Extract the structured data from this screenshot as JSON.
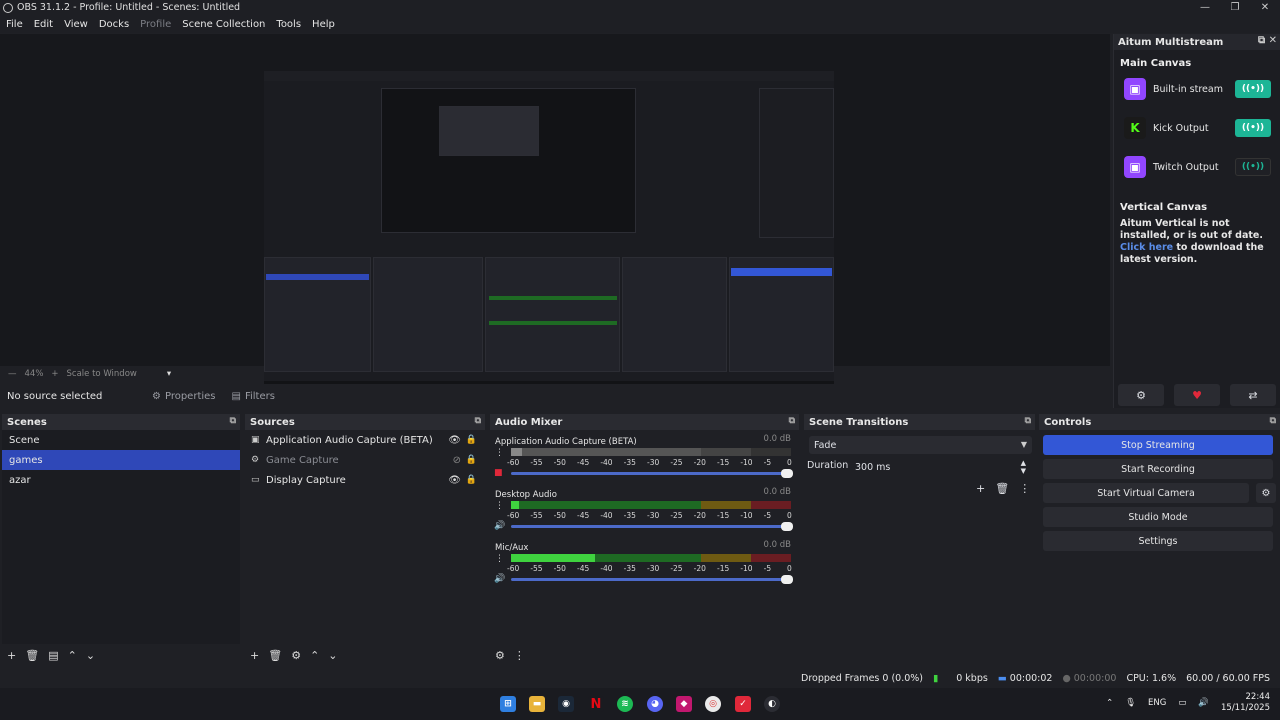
{
  "window": {
    "title": "OBS 31.1.2 - Profile: Untitled - Scenes: Untitled"
  },
  "menu": {
    "items": [
      "File",
      "Edit",
      "View",
      "Docks",
      "Profile",
      "Scene Collection",
      "Tools",
      "Help"
    ]
  },
  "zoom": {
    "percent": "44%",
    "mode": "Scale to Window"
  },
  "source_toolbar": {
    "no_source": "No source selected",
    "properties": "Properties",
    "filters": "Filters"
  },
  "multistream": {
    "title": "Aitum Multistream",
    "main_canvas": "Main Canvas",
    "outputs": [
      {
        "label": "Built-in stream",
        "logo": "twitch-icon",
        "active": true
      },
      {
        "label": "Kick Output",
        "logo": "kick-icon",
        "active": true
      },
      {
        "label": "Twitch Output",
        "logo": "twitch-icon",
        "active": false
      }
    ],
    "vertical_canvas": "Vertical Canvas",
    "vertical_msg": "Aitum Vertical is not installed, or is out of date.",
    "click_here": "Click here",
    "download_msg": "to download the latest version."
  },
  "scenes": {
    "title": "Scenes",
    "items": [
      "Scene",
      "games",
      "azar"
    ],
    "selected": 1
  },
  "sources": {
    "title": "Sources",
    "items": [
      {
        "label": "Application Audio Capture (BETA)",
        "icon": "audio-capture-icon",
        "visible": true
      },
      {
        "label": "Game Capture",
        "icon": "game-capture-icon",
        "visible": false
      },
      {
        "label": "Display Capture",
        "icon": "monitor-icon",
        "visible": true
      }
    ]
  },
  "mixer": {
    "title": "Audio Mixer",
    "channels": [
      {
        "name": "Application Audio Capture (BETA)",
        "db": "0.0 dB",
        "level": 0.04,
        "muted": true
      },
      {
        "name": "Desktop Audio",
        "db": "0.0 dB",
        "level": 0.03,
        "muted": false
      },
      {
        "name": "Mic/Aux",
        "db": "0.0 dB",
        "level": 0.3,
        "muted": false
      }
    ],
    "ticks": [
      "-60",
      "-55",
      "-50",
      "-45",
      "-40",
      "-35",
      "-30",
      "-25",
      "-20",
      "-15",
      "-10",
      "-5",
      "0"
    ]
  },
  "transitions": {
    "title": "Scene Transitions",
    "selected": "Fade",
    "duration_label": "Duration",
    "duration": "300 ms"
  },
  "controls": {
    "title": "Controls",
    "stop_streaming": "Stop Streaming",
    "start_recording": "Start Recording",
    "start_virtual_camera": "Start Virtual Camera",
    "studio_mode": "Studio Mode",
    "settings": "Settings"
  },
  "status": {
    "dropped_frames": "Dropped Frames 0 (0.0%)",
    "kbps": "0 kbps",
    "stream_time": "00:00:02",
    "rec_time": "00:00:00",
    "cpu": "CPU: 1.6%",
    "fps": "60.00 / 60.00 FPS"
  },
  "taskbar": {
    "lang": "ENG",
    "time": "22:44",
    "date": "15/11/2025"
  },
  "colors": {
    "accent": "#3357d6",
    "selection": "#2f48b8",
    "twitch": "#9146ff",
    "kick": "#53fc18",
    "toggle_on": "#1db596"
  }
}
